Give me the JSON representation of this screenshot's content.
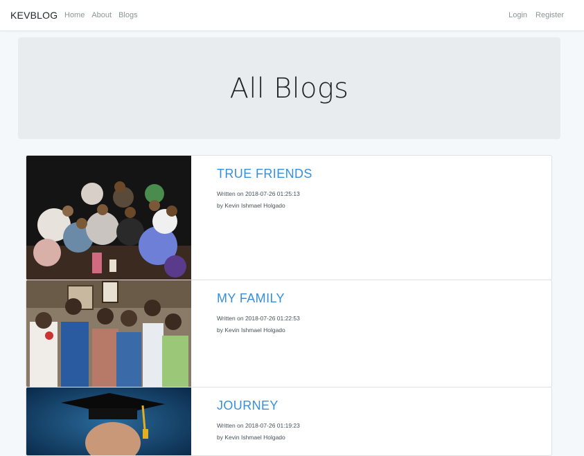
{
  "navbar": {
    "brand": "KEVBLOG",
    "left_links": [
      "Home",
      "About",
      "Blogs"
    ],
    "right_links": [
      "Login",
      "Register"
    ]
  },
  "jumbotron": {
    "title": "All Blogs"
  },
  "posts": [
    {
      "title": "TRUE FRIENDS",
      "written": "Written on 2018-07-26 01:25:13",
      "author": "by Kevin Ishmael Holgado",
      "image": "group-of-friends-night-photo"
    },
    {
      "title": "MY FAMILY",
      "written": "Written on 2018-07-26 01:22:53",
      "author": "by Kevin Ishmael Holgado",
      "image": "family-photo"
    },
    {
      "title": "JOURNEY",
      "written": "Written on 2018-07-26 01:19:23",
      "author": "by Kevin Ishmael Holgado",
      "image": "graduation-portrait"
    }
  ]
}
